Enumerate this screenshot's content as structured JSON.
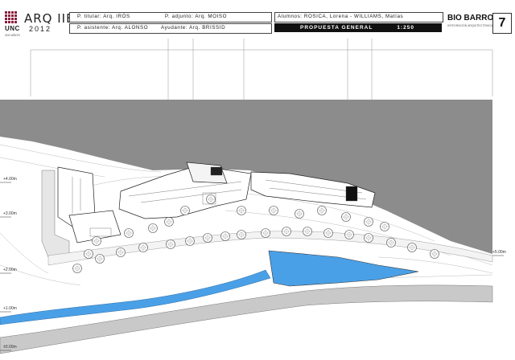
{
  "header": {
    "course_title": "ARQ IIB",
    "year": "2012",
    "university": "UNC",
    "university_sub": "400 AÑOS",
    "titular": "P. titular: Arq. IRÓS",
    "adjunto": "P. adjunto: Arq. MOISO",
    "asistente": "P. asistente: Arq. ALONSO",
    "ayudante": "Ayudante: Arq. BRISSID",
    "alumnos": "Alumnos: ROSICA, Lorena  -  WILLIAMS, Matías",
    "sheet_title": "PROPUESTA GENERAL",
    "scale": "1:250",
    "brand": "BIO BARRO",
    "brand_sub": "INTEGRACIÓN ARQUITECTÓNICA",
    "sheet_number": "7"
  },
  "levels": {
    "l1": "+4.00m",
    "l2": "+3.00m",
    "l3": "+2.00m",
    "l4": "+1.00m",
    "l5": "±0.00m",
    "right": "+5.00m"
  },
  "colors": {
    "hill": "#8c8c8c",
    "water": "#4aa0e6",
    "road": "#c9c9c9",
    "tree": "#555555"
  },
  "icons": [
    "university-logo",
    "tree-symbol",
    "north-arrow"
  ]
}
